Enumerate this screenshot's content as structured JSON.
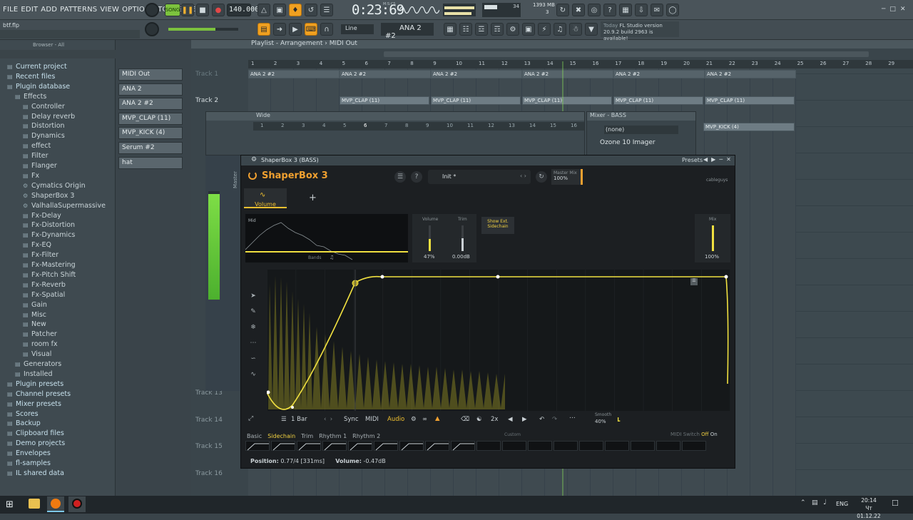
{
  "menu": [
    "FILE",
    "EDIT",
    "ADD",
    "PATTERNS",
    "VIEW",
    "OPTIONS",
    "TOOLS",
    "HELP"
  ],
  "transport": {
    "mode_label": "SONG",
    "tempo": "140.000",
    "time": "0:23:69",
    "time_unit": "M:S:CS",
    "cpu": "34",
    "memory": "1393 MB",
    "voices": "3"
  },
  "project_file": "btf.flp",
  "toolbar2": {
    "snap": "Line",
    "pattern": "ANA 2 #2",
    "news_date": "Today",
    "news_title": "FL Studio version",
    "news_body": "20.9.2 build 2963 is available!"
  },
  "browser": {
    "header": "Browser - All",
    "items": [
      {
        "label": "Current project",
        "icon": "folder",
        "level": 0
      },
      {
        "label": "Recent files",
        "icon": "folder",
        "level": 0
      },
      {
        "label": "Plugin database",
        "icon": "folder",
        "level": 0
      },
      {
        "label": "Effects",
        "icon": "folder",
        "level": 1
      },
      {
        "label": "Controller",
        "icon": "folder",
        "level": 2
      },
      {
        "label": "Delay reverb",
        "icon": "folder",
        "level": 2
      },
      {
        "label": "Distortion",
        "icon": "folder",
        "level": 2
      },
      {
        "label": "Dynamics",
        "icon": "folder",
        "level": 2
      },
      {
        "label": "effect",
        "icon": "folder",
        "level": 2
      },
      {
        "label": "Filter",
        "icon": "folder",
        "level": 2
      },
      {
        "label": "Flanger",
        "icon": "folder",
        "level": 2
      },
      {
        "label": "Fx",
        "icon": "folder",
        "level": 2
      },
      {
        "label": "Cymatics Origin",
        "icon": "plugin",
        "level": 2
      },
      {
        "label": "ShaperBox 3",
        "icon": "plugin",
        "level": 2
      },
      {
        "label": "ValhallaSupermassive",
        "icon": "plugin",
        "level": 2
      },
      {
        "label": "Fx-Delay",
        "icon": "folder",
        "level": 2
      },
      {
        "label": "Fx-Distortion",
        "icon": "folder",
        "level": 2
      },
      {
        "label": "Fx-Dynamics",
        "icon": "folder",
        "level": 2
      },
      {
        "label": "Fx-EQ",
        "icon": "folder",
        "level": 2
      },
      {
        "label": "Fx-Filter",
        "icon": "folder",
        "level": 2
      },
      {
        "label": "Fx-Mastering",
        "icon": "folder",
        "level": 2
      },
      {
        "label": "Fx-Pitch Shift",
        "icon": "folder",
        "level": 2
      },
      {
        "label": "Fx-Reverb",
        "icon": "folder",
        "level": 2
      },
      {
        "label": "Fx-Spatial",
        "icon": "folder",
        "level": 2
      },
      {
        "label": "Gain",
        "icon": "folder",
        "level": 2
      },
      {
        "label": "Misc",
        "icon": "folder",
        "level": 2
      },
      {
        "label": "New",
        "icon": "folder",
        "level": 2
      },
      {
        "label": "Patcher",
        "icon": "folder",
        "level": 2
      },
      {
        "label": "room fx",
        "icon": "folder",
        "level": 2
      },
      {
        "label": "Visual",
        "icon": "folder",
        "level": 2
      },
      {
        "label": "Generators",
        "icon": "folder",
        "level": 1
      },
      {
        "label": "Installed",
        "icon": "folder",
        "level": 1
      },
      {
        "label": "Plugin presets",
        "icon": "folder",
        "level": 0
      },
      {
        "label": "Channel presets",
        "icon": "folder",
        "level": 0
      },
      {
        "label": "Mixer presets",
        "icon": "folder",
        "level": 0
      },
      {
        "label": "Scores",
        "icon": "folder",
        "level": 0
      },
      {
        "label": "Backup",
        "icon": "folder",
        "level": 0
      },
      {
        "label": "Clipboard files",
        "icon": "folder",
        "level": 0
      },
      {
        "label": "Demo projects",
        "icon": "folder",
        "level": 0
      },
      {
        "label": "Envelopes",
        "icon": "folder",
        "level": 0
      },
      {
        "label": "fl-samples",
        "icon": "folder",
        "level": 0
      },
      {
        "label": "IL shared data",
        "icon": "folder",
        "level": 0
      }
    ]
  },
  "channels": [
    "MIDI Out",
    "ANA 2",
    "ANA 2 #2",
    "MVP_CLAP (11)",
    "MVP_KICK (4)",
    "Serum #2",
    "hat"
  ],
  "playlist": {
    "title": "Playlist - Arrangement",
    "pattern": "MIDI Out",
    "ruler": [
      "1",
      "2",
      "3",
      "4",
      "5",
      "6",
      "7",
      "8",
      "9",
      "10",
      "11",
      "12",
      "13",
      "14",
      "15",
      "16",
      "17",
      "18",
      "19",
      "20",
      "21",
      "22",
      "23",
      "24",
      "25",
      "26",
      "27",
      "28",
      "29"
    ],
    "tracks": [
      "Track 1",
      "Track 2",
      "Track 13",
      "Track 14",
      "Track 15",
      "Track 16"
    ],
    "clip_ana": "ANA 2 #2",
    "clip_clap": "MVP_CLAP (11)",
    "clip_kick": "MVP_KICK (4)"
  },
  "channel_rack": {
    "title": "Wide",
    "steps": [
      "1",
      "2",
      "3",
      "4",
      "5",
      "6",
      "7",
      "8",
      "9",
      "10",
      "11",
      "12",
      "13",
      "14",
      "15",
      "16"
    ]
  },
  "mixer": {
    "title": "Mixer - BASS",
    "slot_none": "(none)",
    "slot1": "Ozone 10 Imager",
    "master": "Master"
  },
  "shaperbox": {
    "window_title": "ShaperBox 3 (BASS)",
    "presets_label": "Presets",
    "logo": "ShaperBox 3",
    "preset_name": "Init *",
    "master_mix_label": "Master Mix",
    "master_mix_value": "100%",
    "brand": "cableguys",
    "tab_volume": "Volume",
    "mid_label": "Mid",
    "bands_label": "Bands",
    "volume_label": "Volume",
    "volume_value": "47%",
    "trim_label": "Trim",
    "trim_value": "0.00dB",
    "sidechain_btn": "Show Ext. Sidechain",
    "mix_label": "Mix",
    "mix_value": "100%",
    "length": "1 Bar",
    "sync": "Sync",
    "midi": "MIDI",
    "audio": "Audio",
    "multiplier": "2x",
    "smooth_label": "Smooth",
    "smooth_value": "40%",
    "preset_tabs": [
      "Basic",
      "Sidechain",
      "Trim",
      "Rhythm 1",
      "Rhythm 2"
    ],
    "custom_label": "Custom",
    "midi_switch_label": "MIDI Switch",
    "midi_off": "Off",
    "midi_on": "On",
    "status_position_label": "Position:",
    "status_position_value": "0.77/4 [331ms]",
    "status_volume_label": "Volume:",
    "status_volume_value": "-0.47dB"
  },
  "taskbar": {
    "lang": "ENG",
    "clock_time": "20:14",
    "clock_date": "Чт 01.12.22"
  }
}
